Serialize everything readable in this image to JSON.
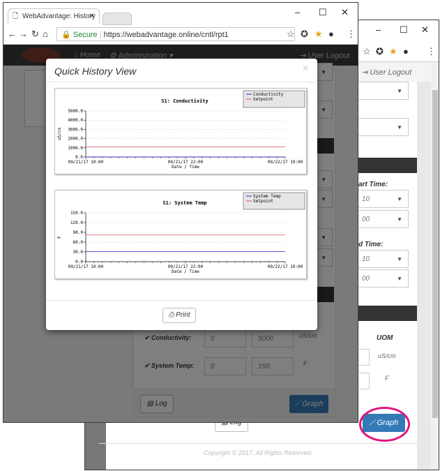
{
  "browser": {
    "tab_title": "WebAdvantage: History",
    "secure_label": "Secure",
    "url": "https://webadvantage.online/cntl/rpt1"
  },
  "nav": {
    "home": "Home",
    "administration": "Administration",
    "user_logout": "User Logout"
  },
  "back_page": {
    "start_time_label": "Start Time:",
    "start_time_partial": "art Time:",
    "start_hour": "10",
    "start_min": "00",
    "end_time_label": "End Time:",
    "end_time_partial": "d Time:",
    "end_hour": "10",
    "end_min": "00",
    "uom_header": "UOM",
    "uom_conductivity": "uS/cm",
    "uom_temp": "F",
    "log_button": "Log",
    "graph_button": "Graph",
    "copyright": "Copyright © 2017. All Rights Reserved."
  },
  "front_page": {
    "conductivity_label": "Conductivity:",
    "conductivity_min": "0",
    "conductivity_max": "5000",
    "conductivity_uom": "uS/cm",
    "temp_label": "System Temp:",
    "temp_min": "0",
    "temp_max": "150",
    "temp_uom": "F",
    "log_button": "Log",
    "graph_button": "Graph"
  },
  "modal": {
    "title": "Quick History View",
    "close": "×",
    "print_button": "Print"
  },
  "colors": {
    "series_primary": "#2b2bd6",
    "series_setpoint": "#e05050",
    "graph_button": "#337ab7",
    "highlight_circle": "#e0157f"
  },
  "chart_data": [
    {
      "type": "line",
      "title": "S1: Conductivity",
      "xlabel": "Date / Time",
      "ylabel": "uS/cm",
      "x_ticks": [
        "09/21/17 10:00",
        "09/21/17 22:00",
        "09/22/17 10:00"
      ],
      "y_ticks": [
        "0.0",
        "1000.0",
        "2000.0",
        "3000.0",
        "4000.0",
        "5000.0"
      ],
      "ylim": [
        0,
        5000
      ],
      "legend_position": "top-right",
      "series": [
        {
          "name": "Conductivity",
          "values": [
            0,
            0
          ]
        },
        {
          "name": "Setpoint",
          "values": [
            1100,
            1100
          ]
        }
      ]
    },
    {
      "type": "line",
      "title": "S1: System Temp",
      "xlabel": "Date / Time",
      "ylabel": "F",
      "x_ticks": [
        "09/21/17 10:00",
        "09/21/17 22:00",
        "09/22/17 10:00"
      ],
      "y_ticks": [
        "0.0",
        "30.0",
        "60.0",
        "90.0",
        "120.0",
        "150.0"
      ],
      "ylim": [
        0,
        150
      ],
      "legend_position": "top-right",
      "series": [
        {
          "name": "System Temp",
          "values": [
            31,
            31
          ]
        },
        {
          "name": "Setpoint",
          "values": [
            82,
            82
          ]
        }
      ]
    }
  ]
}
